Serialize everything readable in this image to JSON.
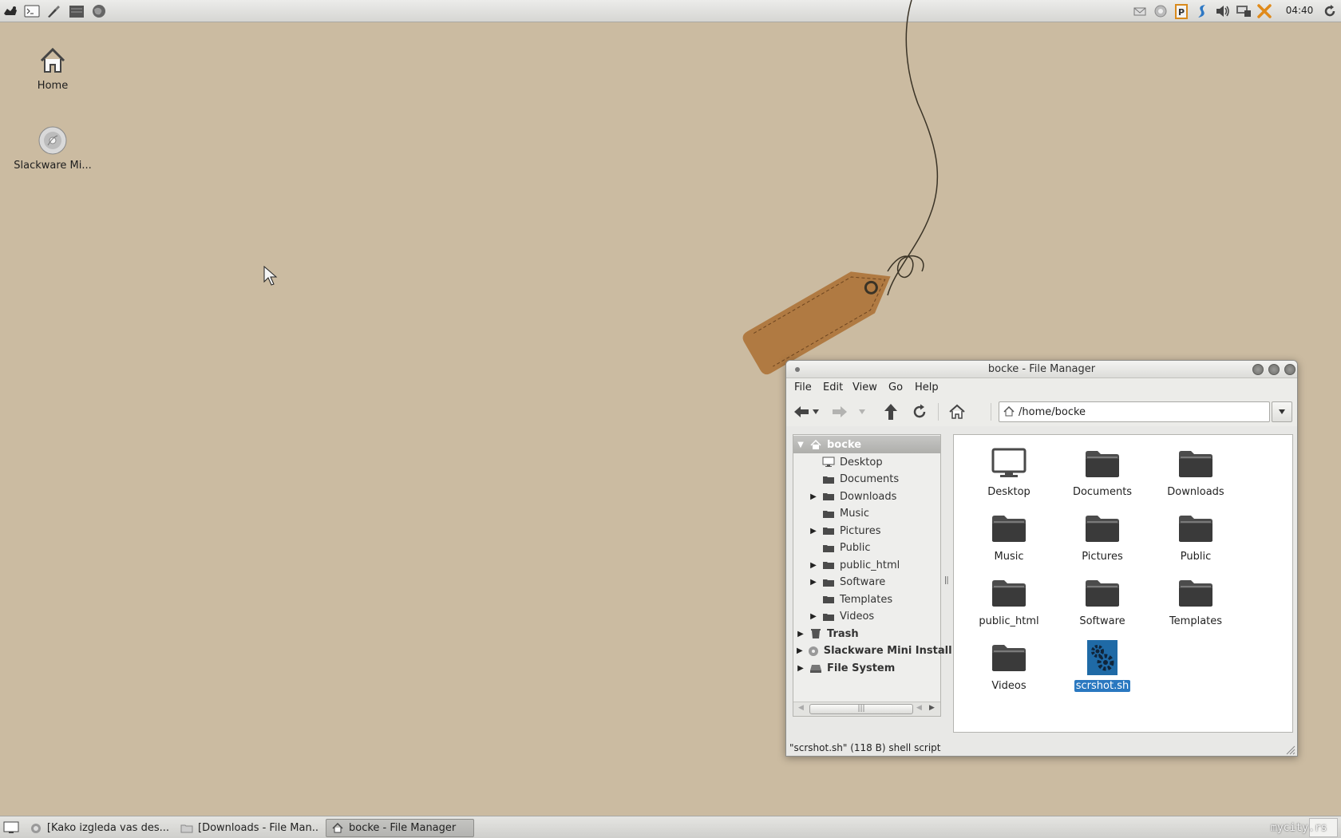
{
  "top_panel": {
    "launchers": [
      "app-menu-icon",
      "terminal-icon",
      "settings-brush-icon",
      "file-manager-icon",
      "web-browser-icon"
    ],
    "tray": [
      "mail-icon",
      "update-notifier-icon",
      "clipboard-icon",
      "steam-icon",
      "volume-icon",
      "network-icon",
      "close-x-icon"
    ],
    "clock": "04:40"
  },
  "desktop": {
    "icons": [
      {
        "label": "Home",
        "icon": "home-icon"
      },
      {
        "label": "Slackware Mi...",
        "icon": "optical-disc-icon"
      }
    ]
  },
  "window": {
    "title": "bocke - File Manager",
    "menu": [
      "File",
      "Edit",
      "View",
      "Go",
      "Help"
    ],
    "location": "/home/bocke",
    "sidebar": {
      "root": "bocke",
      "children": [
        {
          "label": "Desktop",
          "expandable": false,
          "icon": "desktop-icon"
        },
        {
          "label": "Documents",
          "expandable": false,
          "icon": "folder-icon"
        },
        {
          "label": "Downloads",
          "expandable": true,
          "icon": "folder-icon"
        },
        {
          "label": "Music",
          "expandable": false,
          "icon": "folder-icon"
        },
        {
          "label": "Pictures",
          "expandable": true,
          "icon": "folder-icon"
        },
        {
          "label": "Public",
          "expandable": false,
          "icon": "folder-icon"
        },
        {
          "label": "public_html",
          "expandable": true,
          "icon": "folder-icon"
        },
        {
          "label": "Software",
          "expandable": true,
          "icon": "folder-icon"
        },
        {
          "label": "Templates",
          "expandable": false,
          "icon": "folder-icon"
        },
        {
          "label": "Videos",
          "expandable": true,
          "icon": "folder-icon"
        }
      ],
      "other_roots": [
        {
          "label": "Trash",
          "icon": "trash-icon"
        },
        {
          "label": "Slackware Mini Install",
          "icon": "optical-disc-icon"
        },
        {
          "label": "File System",
          "icon": "drive-icon"
        }
      ]
    },
    "files": [
      {
        "label": "Desktop",
        "icon": "desktop-icon"
      },
      {
        "label": "Documents",
        "icon": "folder-icon"
      },
      {
        "label": "Downloads",
        "icon": "folder-icon"
      },
      {
        "label": "Music",
        "icon": "folder-icon"
      },
      {
        "label": "Pictures",
        "icon": "folder-icon"
      },
      {
        "label": "Public",
        "icon": "folder-icon"
      },
      {
        "label": "public_html",
        "icon": "folder-icon"
      },
      {
        "label": "Software",
        "icon": "folder-icon"
      },
      {
        "label": "Templates",
        "icon": "folder-icon"
      },
      {
        "label": "Videos",
        "icon": "folder-icon"
      },
      {
        "label": "scrshot.sh",
        "icon": "shell-script-icon",
        "selected": true
      }
    ],
    "status": "\"scrshot.sh\" (118 B) shell script"
  },
  "taskbar": {
    "tasks": [
      {
        "label": "[Kako izgleda vas des...",
        "icon": "browser-icon",
        "active": false
      },
      {
        "label": "[Downloads - File Man...",
        "icon": "folder-icon",
        "active": false
      },
      {
        "label": "bocke - File Manager",
        "icon": "home-icon",
        "active": true
      }
    ],
    "watermark": "mycity.rs"
  },
  "colors": {
    "desktop_bg": "#cbbba1",
    "selection": "#2a78c0",
    "tag": "#b07a42"
  }
}
